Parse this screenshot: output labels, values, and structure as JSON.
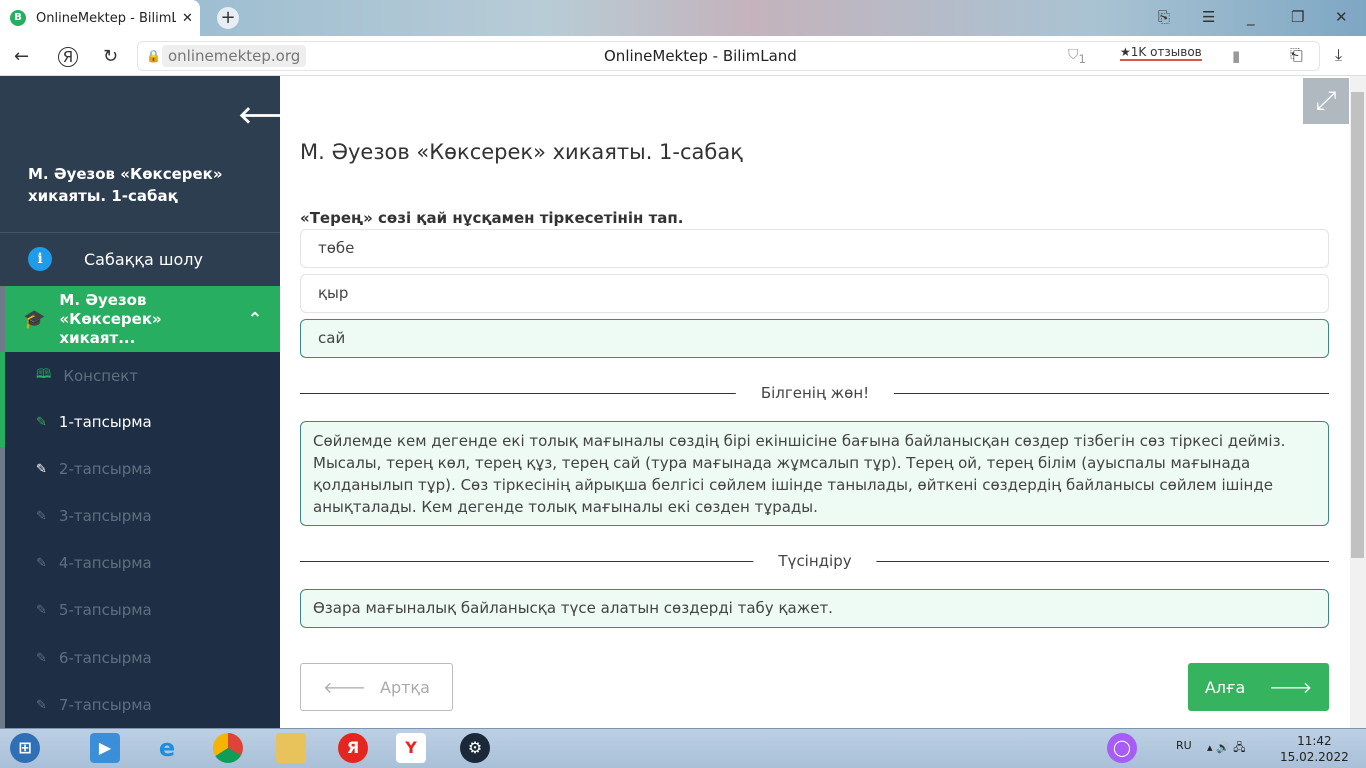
{
  "browser": {
    "tab_title": "OnlineMektep - BilimLand",
    "favicon": "B",
    "url": "onlinemektep.org",
    "page_title": "OnlineMektep - BilimLand",
    "reviews": "★1K отзывов",
    "shield_count": "1"
  },
  "sidebar": {
    "lesson_title": "М. Әуезов «Көксерек» хикаяты. 1-сабақ",
    "overview": "Сабаққа шолу",
    "active_section": "М. Әуезов «Көксерек» хикаят...",
    "items": [
      {
        "label": "Конспект",
        "icon": "book-icon"
      },
      {
        "label": "1-тапсырма",
        "icon": "edit-icon"
      },
      {
        "label": "2-тапсырма",
        "icon": "edit-icon"
      },
      {
        "label": "3-тапсырма",
        "icon": "edit-icon"
      },
      {
        "label": "4-тапсырма",
        "icon": "edit-icon"
      },
      {
        "label": "5-тапсырма",
        "icon": "edit-icon"
      },
      {
        "label": "6-тапсырма",
        "icon": "edit-icon"
      },
      {
        "label": "7-тапсырма",
        "icon": "edit-icon"
      }
    ]
  },
  "main": {
    "title": "М. Әуезов «Көксерек» хикаяты. 1-сабақ",
    "question": "«Терең» сөзі қай нұсқамен тіркесетінін тап.",
    "options": [
      "төбе",
      "қыр",
      "сай"
    ],
    "correct_label": "Білгенің жөн!",
    "info_text": "Сөйлемде кем дегенде екі толық мағыналы сөздің бірі екіншісіне бағына байланысқан сөздер тізбегін сөз тіркесі дейміз. Мысалы, терең көл, терең құз, терең сай (тура мағынада жұмсалып тұр). Терең ой, терең білім (ауыспалы мағынада қолданылып тұр). Сөз тіркесінің айрықша белгісі сөйлем ішінде танылады, өйткені сөздердің байланысы сөйлем ішінде анықталады. Кем дегенде толық мағыналы екі сөзден тұрады.",
    "explain_label": "Түсіндіру",
    "explain_text": "Өзара мағыналық байланысқа түсе алатын сөздерді табу қажет.",
    "prev": "Артқа",
    "next": "Алға"
  },
  "taskbar": {
    "lang": "RU",
    "time": "11:42",
    "date": "15.02.2022"
  },
  "colors": {
    "accent": "#27ae60",
    "sidebar": "#1e2f45"
  }
}
